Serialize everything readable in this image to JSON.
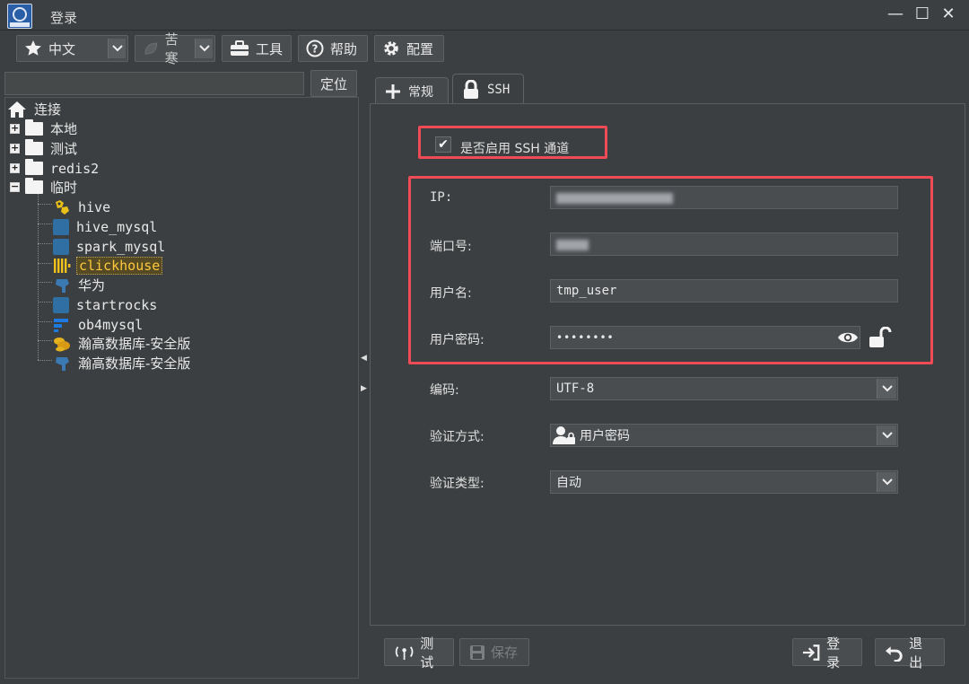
{
  "window": {
    "title": "登录",
    "controls": {
      "minimize": "—",
      "maximize": "☐",
      "close": "✕"
    }
  },
  "toolbar": {
    "language": {
      "value": "中文",
      "icon": "star-icon"
    },
    "theme": {
      "value": "苦寒",
      "icon": "leaf-icon"
    },
    "tools_label": "工具",
    "help_label": "帮助",
    "config_label": "配置"
  },
  "left": {
    "locate_value": "",
    "locate_button": "定位",
    "tree": {
      "root": "连接",
      "groups": [
        "本地",
        "测试",
        "redis2",
        "临时"
      ],
      "items": [
        {
          "label": "hive",
          "icon": "hive-icon",
          "color": "#e8c018"
        },
        {
          "label": "hive_mysql",
          "icon": "mysql-icon",
          "color": "#2f6fa3"
        },
        {
          "label": "spark_mysql",
          "icon": "mysql-icon",
          "color": "#2f6fa3"
        },
        {
          "label": "clickhouse",
          "icon": "clickhouse-icon",
          "color": "#f2c21a",
          "selected": true
        },
        {
          "label": "华为",
          "icon": "postgres-icon",
          "color": "#3b79b3"
        },
        {
          "label": "startrocks",
          "icon": "mysql-icon",
          "color": "#2f6fa3"
        },
        {
          "label": "ob4mysql",
          "icon": "oceanbase-icon",
          "color": "#1f7ae0"
        },
        {
          "label": "瀚高数据库-安全版",
          "icon": "highgo-icon",
          "color": "#e3b21c"
        },
        {
          "label": "瀚高数据库-安全版",
          "icon": "postgres-icon",
          "color": "#3b79b3"
        }
      ]
    }
  },
  "tabs": [
    {
      "label": "常规",
      "icon": "plus-icon"
    },
    {
      "label": "SSH",
      "icon": "lock-icon",
      "active": true
    }
  ],
  "ssh": {
    "enable_label": "是否启用 SSH 通道",
    "enabled": true,
    "fields": {
      "ip_label": "IP:",
      "port_label": "端口号:",
      "user_label": "用户名:",
      "user_value": "tmp_user",
      "password_label": "用户密码:",
      "password_value": "••••••••"
    },
    "encoding_label": "编码:",
    "encoding_value": "UTF-8",
    "auth_method_label": "验证方式:",
    "auth_method_value": "用户密码",
    "auth_type_label": "验证类型:",
    "auth_type_value": "自动"
  },
  "buttons": {
    "test": "测试",
    "save": "保存",
    "login": "登录",
    "exit": "退出"
  },
  "colors": {
    "highlight_border": "#ef4b57",
    "selected_text": "#ffc83d",
    "background": "#3c3f41"
  }
}
